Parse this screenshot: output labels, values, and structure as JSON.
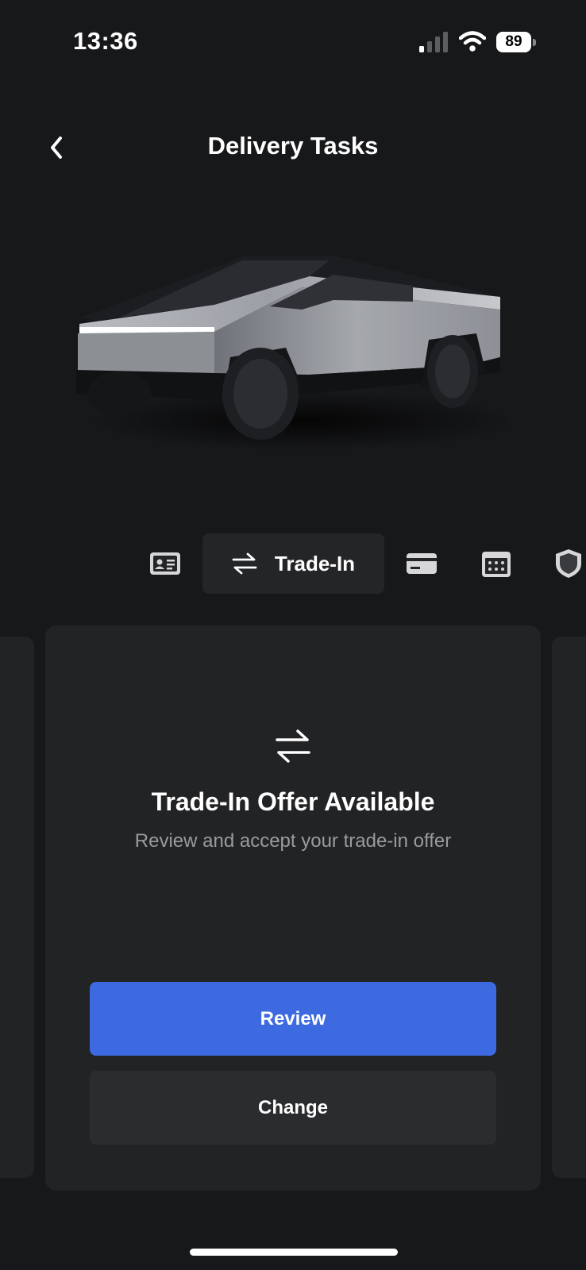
{
  "status_bar": {
    "time": "13:36",
    "battery_level": "89",
    "icons": [
      "cellular-signal-icon",
      "wifi-icon",
      "battery-icon"
    ]
  },
  "nav": {
    "title": "Delivery Tasks",
    "back_icon": "chevron-left-icon"
  },
  "vehicle": {
    "image": "cybertruck-render"
  },
  "tabs": [
    {
      "icon": "id-card-icon",
      "label": "",
      "active": false
    },
    {
      "icon": "swap-arrows-icon",
      "label": "Trade-In",
      "active": true
    },
    {
      "icon": "credit-card-icon",
      "label": "",
      "active": false
    },
    {
      "icon": "calendar-icon",
      "label": "",
      "active": false
    },
    {
      "icon": "shield-icon",
      "label": "",
      "active": false
    }
  ],
  "card": {
    "icon": "swap-arrows-icon",
    "title": "Trade-In Offer Available",
    "subtitle": "Review and accept your trade-in offer",
    "primary_button": "Review",
    "secondary_button": "Change"
  },
  "colors": {
    "background": "#17181a",
    "card": "#222325",
    "primary": "#3e6ae1",
    "secondary_button": "#2b2c2e",
    "muted_text": "#9a9b9e"
  }
}
